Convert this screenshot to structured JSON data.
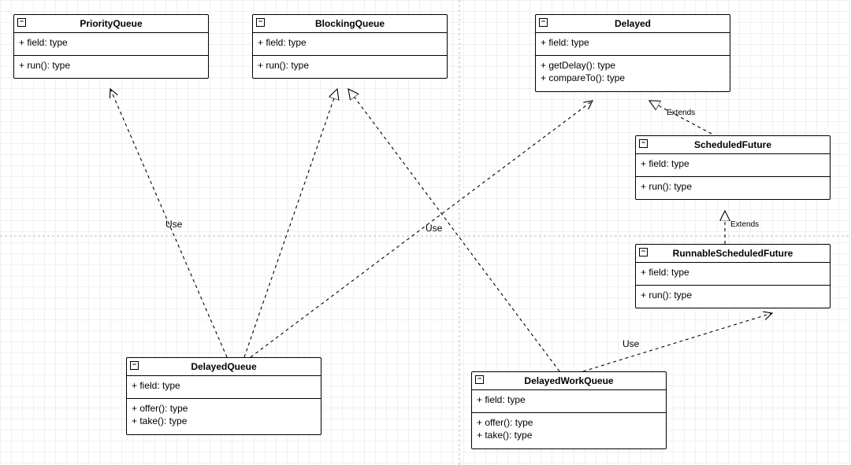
{
  "classes": {
    "PriorityQueue": {
      "name": "PriorityQueue",
      "fields": [
        "+ field: type"
      ],
      "methods": [
        "+ run(): type"
      ]
    },
    "BlockingQueue": {
      "name": "BlockingQueue",
      "fields": [
        "+ field: type"
      ],
      "methods": [
        "+ run(): type"
      ]
    },
    "Delayed": {
      "name": "Delayed",
      "fields": [
        "+ field: type"
      ],
      "methods": [
        "+ getDelay(): type",
        "+ compareTo(): type"
      ]
    },
    "ScheduledFuture": {
      "name": "ScheduledFuture",
      "fields": [
        "+ field: type"
      ],
      "methods": [
        "+ run(): type"
      ]
    },
    "RunnableScheduledFuture": {
      "name": "RunnableScheduledFuture",
      "fields": [
        "+ field: type"
      ],
      "methods": [
        "+ run(): type"
      ]
    },
    "DelayedQueue": {
      "name": "DelayedQueue",
      "fields": [
        "+ field: type"
      ],
      "methods": [
        "+ offer(): type",
        "+ take(): type"
      ]
    },
    "DelayedWorkQueue": {
      "name": "DelayedWorkQueue",
      "fields": [
        "+ field: type"
      ],
      "methods": [
        "+ offer(): type",
        "+ take(): type"
      ]
    }
  },
  "relations": {
    "r1": {
      "from": "DelayedQueue",
      "to": "PriorityQueue",
      "type": "dependency",
      "label": "Use"
    },
    "r2": {
      "from": "DelayedQueue",
      "to": "BlockingQueue",
      "type": "realization",
      "label": ""
    },
    "r3": {
      "from": "DelayedQueue",
      "to": "Delayed",
      "type": "dependency",
      "label": "Use"
    },
    "r4": {
      "from": "DelayedWorkQueue",
      "to": "BlockingQueue",
      "type": "realization",
      "label": ""
    },
    "r5": {
      "from": "DelayedWorkQueue",
      "to": "RunnableScheduledFuture",
      "type": "dependency",
      "label": "Use"
    },
    "r6": {
      "from": "ScheduledFuture",
      "to": "Delayed",
      "type": "generalization",
      "label": "Extends"
    },
    "r7": {
      "from": "RunnableScheduledFuture",
      "to": "ScheduledFuture",
      "type": "generalization",
      "label": "Extends"
    }
  },
  "labels": {
    "use1": "Use",
    "use2": "Use",
    "use3": "Use",
    "ext1": "Extends",
    "ext2": "Extends"
  },
  "icons": {
    "collapse": "−"
  }
}
